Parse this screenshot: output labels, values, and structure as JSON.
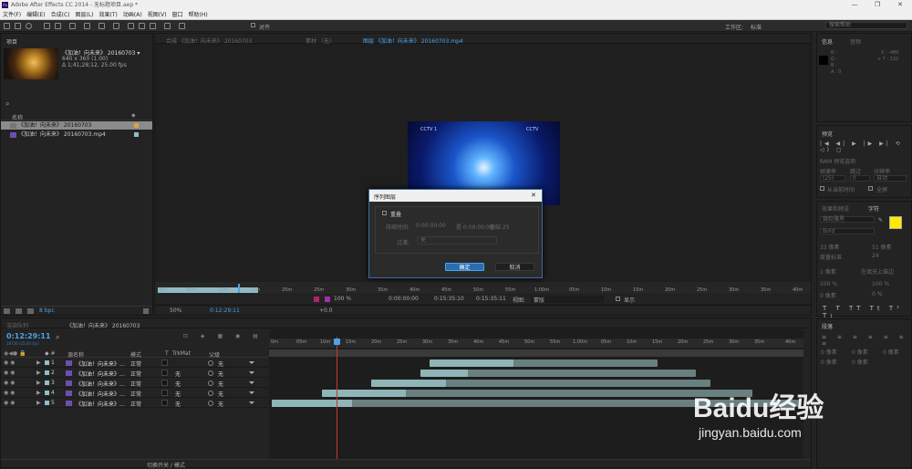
{
  "window": {
    "title": "Adobe After Effects CC 2014 - 无标题项目.aep *",
    "logo_text": "Ae",
    "min": "—",
    "max": "❐",
    "close": "✕"
  },
  "menu": [
    "文件(F)",
    "编辑(E)",
    "合成(C)",
    "图层(L)",
    "效果(T)",
    "动画(A)",
    "视图(V)",
    "窗口",
    "帮助(H)"
  ],
  "toolbar": {
    "snap_label": "对齐",
    "workspace_label": "工作区:",
    "workspace_value": "标准",
    "search_placeholder": "搜索帮助"
  },
  "project": {
    "tab": "项目",
    "preview_title": "《加油！向未来》 20160703 ▾",
    "preview_info1": "640 x 360 (1.00)",
    "preview_info2": "Δ 1;41;28;12, 25.00 fps",
    "search_icon_label": "⌕",
    "col_name": "名称",
    "items": [
      {
        "name": "《加油！向未来》 20160703",
        "selected": true
      },
      {
        "name": "《加油！向未来》 20160703.mp4",
        "selected": false
      }
    ],
    "bpc": "8 bpc"
  },
  "viewer": {
    "tabs": [
      {
        "label": "合成 《加油！向未来》 20160703",
        "active": false
      },
      {
        "label": "素材 （无）",
        "active": false
      },
      {
        "label": "图层 《加油！向未来》 20160703.mp4",
        "active": true
      }
    ],
    "ruler": [
      "0m",
      "05m",
      "10m",
      "15m",
      "20m",
      "25m",
      "30m",
      "35m",
      "40m",
      "45m",
      "50m",
      "55m",
      "1:00m",
      "05m",
      "10m",
      "15m",
      "20m",
      "25m",
      "30m",
      "35m",
      "40m"
    ],
    "controls": {
      "zoom": "100 %",
      "time1": "0:00:00:00",
      "time2": "0:15:35:10",
      "time3": "0:15:35:11",
      "view_label": "视图:",
      "view_value": "蒙版",
      "show": "显示",
      "exposure": "+0.0",
      "zoom2": "50%",
      "timecode": "0:12:29:11"
    }
  },
  "dialog": {
    "title": "序列图层",
    "close": "✕",
    "overlap_label": "重叠",
    "duration_label": "持续时间:",
    "duration_value": "0:00:00:00",
    "delta": "是 0:00:00:00",
    "base": "基础 25",
    "transition_label": "过渡:",
    "transition_value": "关",
    "ok": "确定",
    "cancel": "取消"
  },
  "timeline": {
    "tabs": [
      "渲染队列",
      "《加油！向未来》 20160703"
    ],
    "timecode": "0:12:29:11",
    "fps": "18736 (25.00 fps)",
    "search": "⌕",
    "col_source": "源名称",
    "col_mode": "模式",
    "col_t": "T",
    "col_trkmat": "TrkMat",
    "col_parent": "父级",
    "ruler": [
      "0m",
      "05m",
      "10m",
      "15m",
      "20m",
      "25m",
      "30m",
      "35m",
      "40m",
      "45m",
      "50m",
      "55m",
      "1:00m",
      "05m",
      "10m",
      "15m",
      "20m",
      "25m",
      "30m",
      "35m",
      "40m"
    ],
    "footer": "切换开关 / 模式",
    "layers": [
      {
        "num": "1",
        "name": "《加油！向未来》...",
        "mode": "正常",
        "trkmat": "",
        "parent": "无"
      },
      {
        "num": "2",
        "name": "《加油！向未来》...",
        "mode": "正常",
        "trkmat": "无",
        "parent": "无"
      },
      {
        "num": "3",
        "name": "《加油！向未来》...",
        "mode": "正常",
        "trkmat": "无",
        "parent": "无"
      },
      {
        "num": "4",
        "name": "《加油！向未来》...",
        "mode": "正常",
        "trkmat": "无",
        "parent": "无"
      },
      {
        "num": "5",
        "name": "《加油！向未来》...",
        "mode": "正常",
        "trkmat": "无",
        "parent": "无"
      }
    ]
  },
  "info": {
    "tabs": [
      "信息",
      "音频"
    ],
    "r": "R :",
    "g": "G :",
    "b": "B :",
    "a": "A : 0",
    "x": "X : -486",
    "y": "+ Y : 132"
  },
  "preview": {
    "tab": "预览",
    "ram": "RAM 预览选项",
    "rate_label": "帧速率",
    "skip_label": "跳过",
    "res_label": "分辨率",
    "rate": "(25)",
    "skip": "0",
    "res": "自动",
    "from_current": "从当前时间",
    "fullscreen": "全屏"
  },
  "character": {
    "tabs": [
      "效果和预设",
      "字符"
    ],
    "font": "微软雅黑",
    "style": "Bold",
    "size": "33 像素",
    "leading": "51 像素",
    "kerning": "度量标准",
    "tracking": "24",
    "stroke": "1 像素",
    "stroke_mode": "在填充上描边",
    "vscale": "100 %",
    "hscale": "100 %",
    "baseline": "0 像素",
    "tsume": "0 %",
    "styles": "T T TT Tt T¹ T₁",
    "color_yellow": "#ffea00"
  },
  "paragraph": {
    "tab": "段落",
    "v1": "0 像素",
    "v2": "0 像素",
    "v3": "0 像素",
    "v4": "0 像素",
    "v5": "0 像素"
  },
  "watermark": {
    "brand": "Baidu经验",
    "url": "jingyan.baidu.com"
  }
}
